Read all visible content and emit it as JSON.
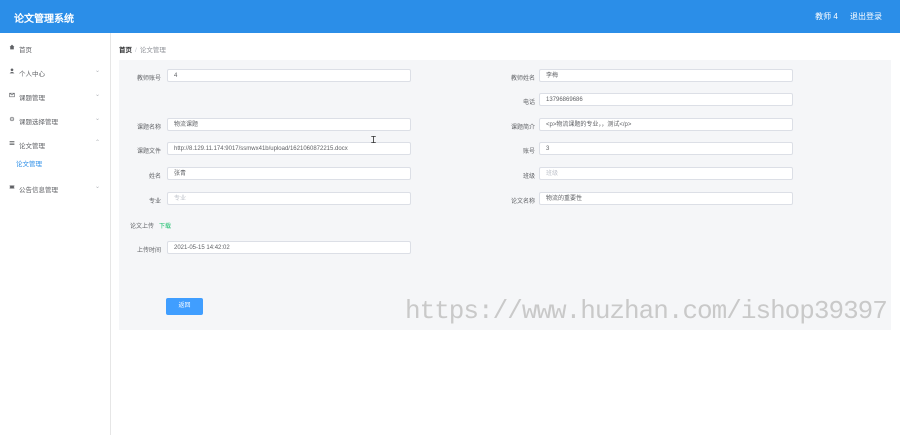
{
  "header": {
    "app_title": "论文管理系统",
    "user_label": "教师 4",
    "logout_label": "退出登录"
  },
  "sidebar": {
    "items": [
      {
        "label": "首页",
        "icon": "home-icon"
      },
      {
        "label": "个人中心",
        "icon": "user-icon"
      },
      {
        "label": "课题管理",
        "icon": "mail-icon"
      },
      {
        "label": "课题选择管理",
        "icon": "settings-icon"
      },
      {
        "label": "论文管理",
        "icon": "list-icon"
      },
      {
        "label": "公告信息管理",
        "icon": "ticket-icon"
      }
    ],
    "subitem": "论文管理"
  },
  "breadcrumb": {
    "home": "首页",
    "sep": "/",
    "current": "论文管理"
  },
  "form": {
    "teacher_no_label": "教师账号",
    "teacher_no_value": "4",
    "teacher_name_label": "教师姓名",
    "teacher_name_value": "李梅",
    "phone_label": "电话",
    "phone_value": "13796869686",
    "topic_name_label": "课题名称",
    "topic_name_value": "物流课题",
    "topic_intro_label": "课题简介",
    "topic_intro_value": "<p>物流课题的专业，，测试</p>",
    "topic_file_label": "课题文件",
    "topic_file_value": "http://8.129.11.174:9017/ssmwx41b/upload/1621060872215.docx",
    "account_label": "账号",
    "account_value": "3",
    "name_label": "姓名",
    "name_value": "张青",
    "class_label": "班级",
    "class_placeholder": "班级",
    "major_label": "专业",
    "major_placeholder": "专业",
    "paper_name_label": "论文名称",
    "paper_name_value": "物流的重要性",
    "paper_upload_label": "论文上传",
    "download_label": "下载",
    "upload_time_label": "上传时间",
    "upload_time_value": "2021-05-15 14:42:02",
    "back_button": "返回"
  },
  "watermark": "https://www.huzhan.com/ishop39397"
}
